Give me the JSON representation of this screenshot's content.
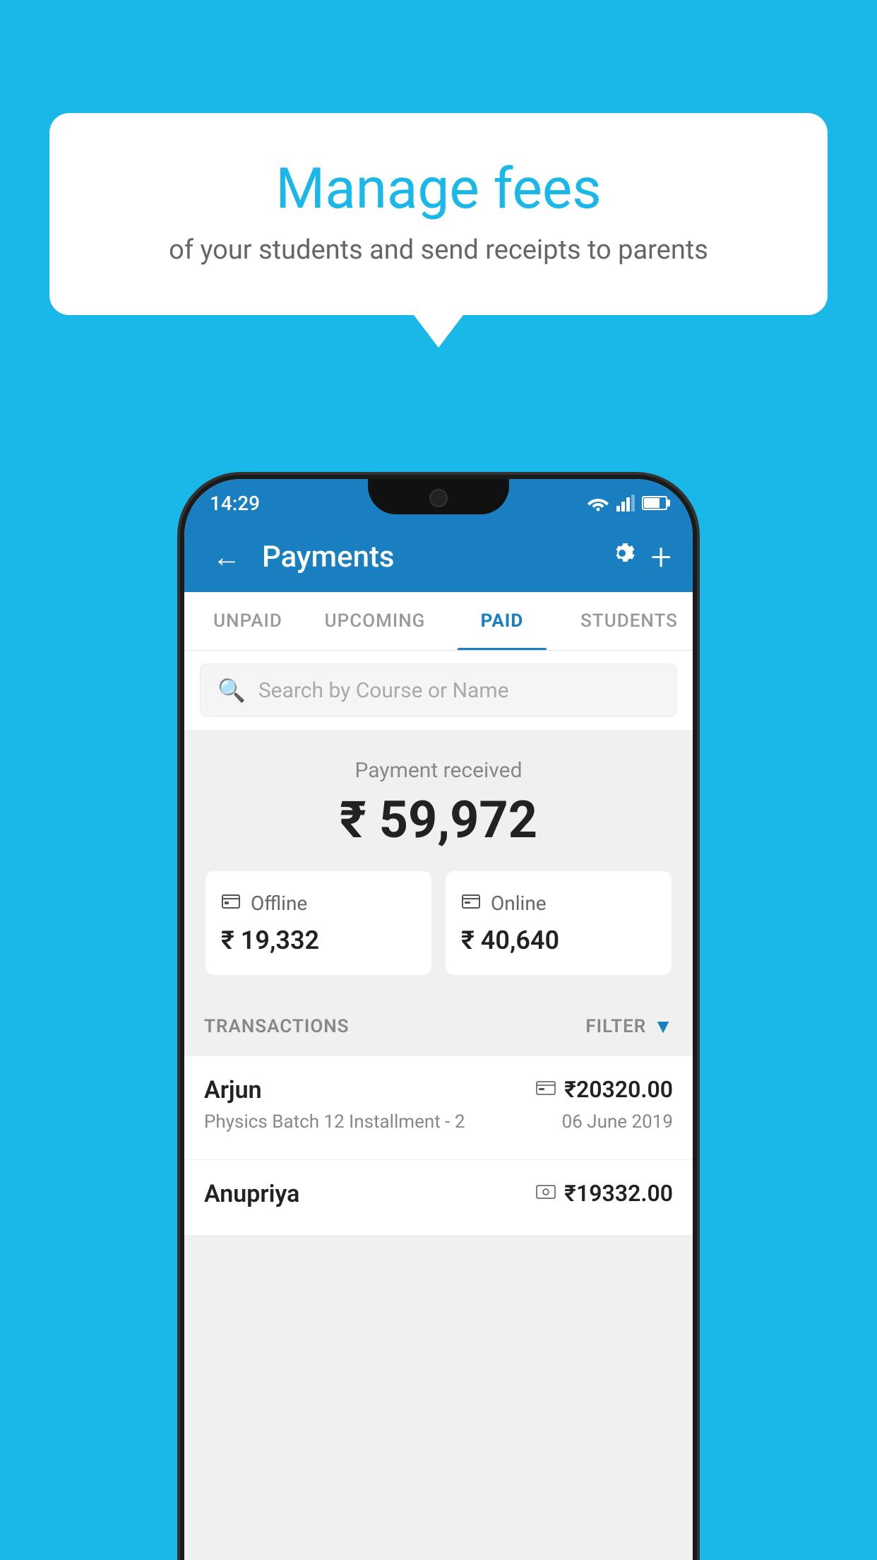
{
  "background_color": "#1ab8e8",
  "speech_bubble": {
    "title": "Manage fees",
    "subtitle": "of your students and send receipts to parents"
  },
  "status_bar": {
    "time": "14:29"
  },
  "app_header": {
    "title": "Payments",
    "back_label": "←",
    "plus_label": "+"
  },
  "tabs": [
    {
      "id": "unpaid",
      "label": "UNPAID",
      "active": false
    },
    {
      "id": "upcoming",
      "label": "UPCOMING",
      "active": false
    },
    {
      "id": "paid",
      "label": "PAID",
      "active": true
    },
    {
      "id": "students",
      "label": "STUDENTS",
      "active": false
    }
  ],
  "search": {
    "placeholder": "Search by Course or Name"
  },
  "payment_summary": {
    "label": "Payment received",
    "total": "₹ 59,972",
    "offline": {
      "type": "Offline",
      "amount": "₹ 19,332"
    },
    "online": {
      "type": "Online",
      "amount": "₹ 40,640"
    }
  },
  "transactions": {
    "header_label": "TRANSACTIONS",
    "filter_label": "FILTER",
    "items": [
      {
        "name": "Arjun",
        "amount": "₹20320.00",
        "detail": "Physics Batch 12 Installment - 2",
        "date": "06 June 2019",
        "payment_type": "card"
      },
      {
        "name": "Anupriya",
        "amount": "₹19332.00",
        "detail": "",
        "date": "",
        "payment_type": "cash"
      }
    ]
  }
}
